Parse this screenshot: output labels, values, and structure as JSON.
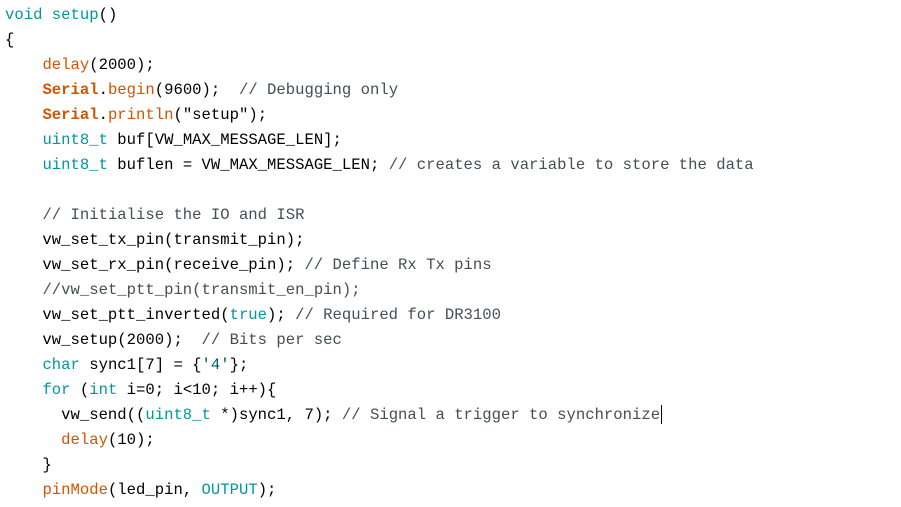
{
  "editor": {
    "lines": [
      [
        {
          "t": "void",
          "c": "kw"
        },
        {
          "t": " "
        },
        {
          "t": "setup",
          "c": "kw"
        },
        {
          "t": "()"
        }
      ],
      [
        {
          "t": "{"
        }
      ],
      [
        {
          "t": "    "
        },
        {
          "t": "delay",
          "c": "fn"
        },
        {
          "t": "(2000);"
        }
      ],
      [
        {
          "t": "    "
        },
        {
          "t": "Serial",
          "c": "cls"
        },
        {
          "t": "."
        },
        {
          "t": "begin",
          "c": "fn"
        },
        {
          "t": "(9600);  "
        },
        {
          "t": "// Debugging only",
          "c": "cm"
        }
      ],
      [
        {
          "t": "    "
        },
        {
          "t": "Serial",
          "c": "cls"
        },
        {
          "t": "."
        },
        {
          "t": "println",
          "c": "fn"
        },
        {
          "t": "(\"setup\");"
        }
      ],
      [
        {
          "t": "    "
        },
        {
          "t": "uint8_t",
          "c": "kw"
        },
        {
          "t": " buf[VW_MAX_MESSAGE_LEN];"
        }
      ],
      [
        {
          "t": "    "
        },
        {
          "t": "uint8_t",
          "c": "kw"
        },
        {
          "t": " buflen = VW_MAX_MESSAGE_LEN; "
        },
        {
          "t": "// creates a variable to store the data",
          "c": "cm"
        }
      ],
      [
        {
          "t": ""
        }
      ],
      [
        {
          "t": "    "
        },
        {
          "t": "// Initialise the IO and ISR",
          "c": "cm"
        }
      ],
      [
        {
          "t": "    vw_set_tx_pin(transmit_pin);"
        }
      ],
      [
        {
          "t": "    vw_set_rx_pin(receive_pin); "
        },
        {
          "t": "// Define Rx Tx pins",
          "c": "cm"
        }
      ],
      [
        {
          "t": "    "
        },
        {
          "t": "//vw_set_ptt_pin(transmit_en_pin);",
          "c": "cm"
        }
      ],
      [
        {
          "t": "    vw_set_ptt_inverted("
        },
        {
          "t": "true",
          "c": "kw"
        },
        {
          "t": "); "
        },
        {
          "t": "// Required for DR3100",
          "c": "cm"
        }
      ],
      [
        {
          "t": "    vw_setup(2000);  "
        },
        {
          "t": "// Bits per sec",
          "c": "cm"
        }
      ],
      [
        {
          "t": "    "
        },
        {
          "t": "char",
          "c": "kw"
        },
        {
          "t": " sync1[7] = {"
        },
        {
          "t": "'4'",
          "c": "str"
        },
        {
          "t": "};"
        }
      ],
      [
        {
          "t": "    "
        },
        {
          "t": "for",
          "c": "kw"
        },
        {
          "t": " ("
        },
        {
          "t": "int",
          "c": "kw"
        },
        {
          "t": " i=0; i<10; i++){"
        }
      ],
      [
        {
          "t": "      vw_send(("
        },
        {
          "t": "uint8_t",
          "c": "kw"
        },
        {
          "t": " *)sync1, 7); "
        },
        {
          "t": "// Signal a trigger to synchronize",
          "c": "cm"
        },
        {
          "caret": true
        }
      ],
      [
        {
          "t": "      "
        },
        {
          "t": "delay",
          "c": "fn"
        },
        {
          "t": "(10);"
        }
      ],
      [
        {
          "t": "    }"
        }
      ],
      [
        {
          "t": "    "
        },
        {
          "t": "pinMode",
          "c": "fn"
        },
        {
          "t": "(led_pin, "
        },
        {
          "t": "OUTPUT",
          "c": "kw"
        },
        {
          "t": ");"
        }
      ]
    ]
  }
}
